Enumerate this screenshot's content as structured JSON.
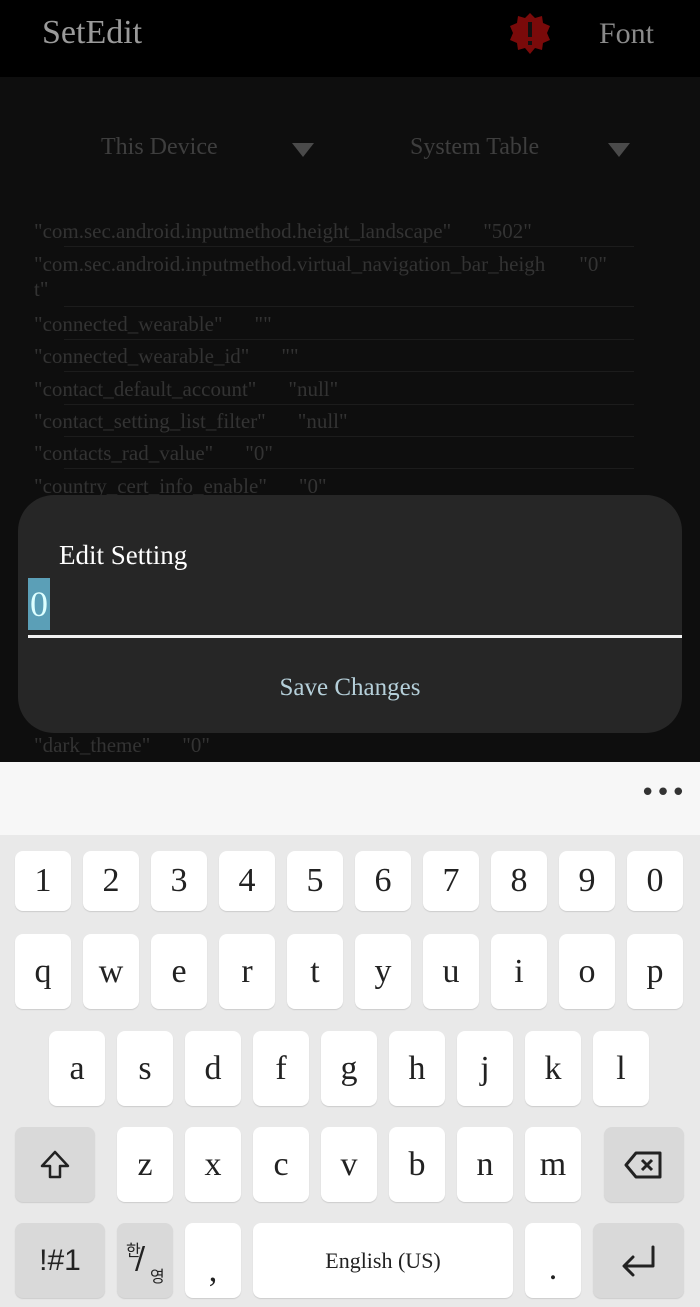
{
  "app": {
    "title": "SetEdit",
    "font_button": "Font",
    "alert_color": "#7a0a0a"
  },
  "dropdowns": [
    {
      "label": "This Device"
    },
    {
      "label": "System Table"
    }
  ],
  "rows": [
    {
      "key": "\"com.sec.android.inputmethod.height_landscape\"",
      "value": "\"502\""
    },
    {
      "key": "\"com.sec.android.inputmethod.virtual_navigation_bar_heigh",
      "key2": "t\"",
      "value": "\"0\""
    },
    {
      "key": "\"connected_wearable\"",
      "value": "\"\""
    },
    {
      "key": "\"connected_wearable_id\"",
      "value": "\"\""
    },
    {
      "key": "\"contact_default_account\"",
      "value": "\"null\""
    },
    {
      "key": "\"contact_setting_list_filter\"",
      "value": "\"null\""
    },
    {
      "key": "\"contacts_rad_value\"",
      "value": "\"0\""
    },
    {
      "key": "\"country_cert_info_enable\"",
      "value": "\"0\""
    },
    {
      "key": "\"dark_theme\"",
      "value": "\"0\""
    }
  ],
  "dialog": {
    "title": "Edit Setting",
    "value": "0",
    "save": "Save Changes"
  },
  "keyboard": {
    "more": "•••",
    "numbers": [
      "1",
      "2",
      "3",
      "4",
      "5",
      "6",
      "7",
      "8",
      "9",
      "0"
    ],
    "row1": [
      "q",
      "w",
      "e",
      "r",
      "t",
      "y",
      "u",
      "i",
      "o",
      "p"
    ],
    "row2": [
      "a",
      "s",
      "d",
      "f",
      "g",
      "h",
      "j",
      "k",
      "l"
    ],
    "row3": [
      "z",
      "x",
      "c",
      "v",
      "b",
      "n",
      "m"
    ],
    "symbols": "!#1",
    "lang_top": "한",
    "lang_bottom": "영",
    "comma": ",",
    "space": "English (US)",
    "period": "."
  }
}
